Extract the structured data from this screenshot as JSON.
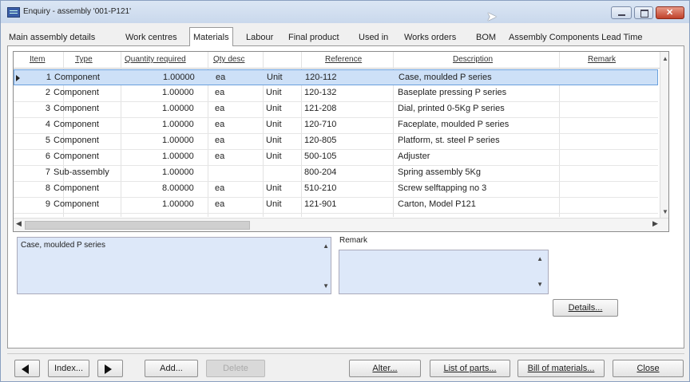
{
  "window": {
    "title": "Enquiry - assembly '001-P121'"
  },
  "tabs": [
    {
      "label": "Main assembly details"
    },
    {
      "label": "Work centres"
    },
    {
      "label": "Materials"
    },
    {
      "label": "Labour"
    },
    {
      "label": "Final product"
    },
    {
      "label": "Used in"
    },
    {
      "label": "Works orders"
    },
    {
      "label": "BOM"
    },
    {
      "label": "Assembly Components Lead Time"
    }
  ],
  "active_tab": "Materials",
  "grid": {
    "columns": [
      "Item",
      "Type",
      "Quantity required",
      "Qty desc",
      "",
      "Reference",
      "Description",
      "Remark"
    ],
    "selected_row": 0,
    "rows": [
      {
        "item": "1",
        "type": "Component",
        "qty": "1.00000",
        "qty_desc": "ea",
        "unit": "Unit",
        "reference": "120-112",
        "description": "Case, moulded P series",
        "remark": ""
      },
      {
        "item": "2",
        "type": "Component",
        "qty": "1.00000",
        "qty_desc": "ea",
        "unit": "Unit",
        "reference": "120-132",
        "description": "Baseplate pressing P series",
        "remark": ""
      },
      {
        "item": "3",
        "type": "Component",
        "qty": "1.00000",
        "qty_desc": "ea",
        "unit": "Unit",
        "reference": "121-208",
        "description": "Dial, printed 0-5Kg P series",
        "remark": ""
      },
      {
        "item": "4",
        "type": "Component",
        "qty": "1.00000",
        "qty_desc": "ea",
        "unit": "Unit",
        "reference": "120-710",
        "description": "Faceplate, moulded P series",
        "remark": ""
      },
      {
        "item": "5",
        "type": "Component",
        "qty": "1.00000",
        "qty_desc": "ea",
        "unit": "Unit",
        "reference": "120-805",
        "description": "Platform, st. steel P series",
        "remark": ""
      },
      {
        "item": "6",
        "type": "Component",
        "qty": "1.00000",
        "qty_desc": "ea",
        "unit": "Unit",
        "reference": "500-105",
        "description": "Adjuster",
        "remark": ""
      },
      {
        "item": "7",
        "type": "Sub-assembly",
        "qty": "1.00000",
        "qty_desc": "",
        "unit": "",
        "reference": "800-204",
        "description": "Spring assembly 5Kg",
        "remark": ""
      },
      {
        "item": "8",
        "type": "Component",
        "qty": "8.00000",
        "qty_desc": "ea",
        "unit": "Unit",
        "reference": "510-210",
        "description": "Screw selftapping no 3",
        "remark": ""
      },
      {
        "item": "9",
        "type": "Component",
        "qty": "1.00000",
        "qty_desc": "ea",
        "unit": "Unit",
        "reference": "121-901",
        "description": "Carton, Model P121",
        "remark": ""
      }
    ]
  },
  "description_box": {
    "text": "Case, moulded P series"
  },
  "remark": {
    "label": "Remark",
    "text": ""
  },
  "buttons": {
    "details": "Details...",
    "index": "Index...",
    "add": "Add...",
    "delete": "Delete",
    "alter": "Alter...",
    "list_of_parts": "List of parts...",
    "bill_of_materials": "Bill of materials...",
    "close": "Close"
  }
}
